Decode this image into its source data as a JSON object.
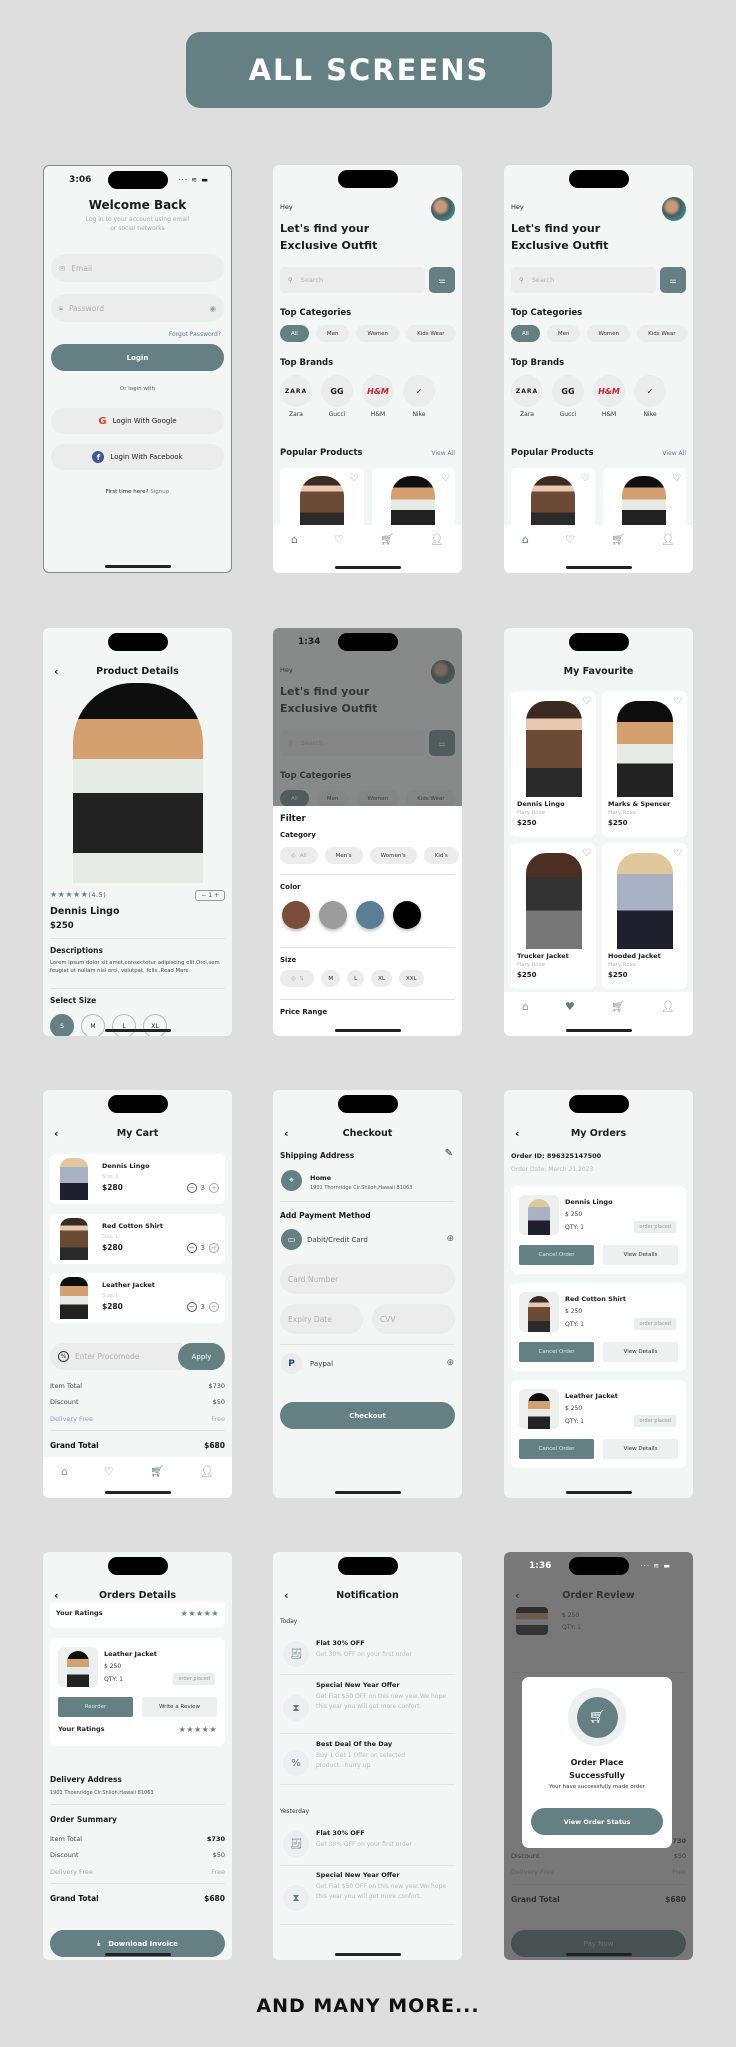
{
  "banner": {
    "title": "ALL SCREENS"
  },
  "footer": {
    "text": "AND MANY MORE..."
  },
  "colors": {
    "accent": "#648083",
    "background": "#dedede",
    "screen": "#f4f6f6"
  },
  "login": {
    "time": "3:06",
    "title": "Welcome Back",
    "subtitle": "Log in to your account using email or social networks",
    "email_placeholder": "Email",
    "password_placeholder": "Password",
    "forgot": "Forgot Password?",
    "login_button": "Login",
    "or_login": "Or login with",
    "google": "Login With Google",
    "facebook": "Login With Facebook",
    "first_time": "First time here?",
    "signup": "Signup"
  },
  "home": {
    "hey": "Hey",
    "title": "Let's find your Exclusive Outfit",
    "search_placeholder": "Search",
    "top_categories": "Top Categories",
    "categories": [
      "All",
      "Men",
      "Women",
      "Kids Wear"
    ],
    "top_brands": "Top Brands",
    "brands": [
      {
        "name": "Zara",
        "logo": "ZARA"
      },
      {
        "name": "Gucci",
        "logo": "GG"
      },
      {
        "name": "H&M",
        "logo": "H&M"
      },
      {
        "name": "Nike",
        "logo": "✓"
      }
    ],
    "popular_products": "Popular Products",
    "view_all": "View All"
  },
  "product_details": {
    "title": "Product Details",
    "rating": "(4.5)",
    "quantity": "1",
    "name": "Dennis Lingo",
    "price": "$250",
    "descriptions_title": "Descriptions",
    "description": "Lorem ipsum dolor sit amet,consectetur adipiscing elit.Orci,sem feugiat ut nullam nisl orci, volutpat, felis..Read More",
    "select_size": "Select Size",
    "sizes": [
      "S",
      "M",
      "L",
      "XL"
    ]
  },
  "filter": {
    "time": "1:34",
    "title": "Filter",
    "category_label": "Category",
    "categories": [
      "All",
      "Men's",
      "Women's",
      "Kid's"
    ],
    "color_label": "Color",
    "colors": [
      "#7a4e3b",
      "#9c9c9c",
      "#5a7f95",
      "#000000"
    ],
    "size_label": "Size",
    "sizes": [
      "S",
      "M",
      "L",
      "XL",
      "XXL"
    ],
    "price_range_label": "Price Range"
  },
  "favourites": {
    "title": "My Favourite",
    "items": [
      {
        "name": "Dennis Lingo",
        "sub": "Hary Rose",
        "price": "$250"
      },
      {
        "name": "Marks & Spencer",
        "sub": "Hary Rose",
        "price": "$250"
      },
      {
        "name": "Trucker Jacket",
        "sub": "Hary Rose",
        "price": "$250"
      },
      {
        "name": "Hooded Jacket",
        "sub": "Hary Rose",
        "price": "$250"
      }
    ]
  },
  "cart": {
    "title": "My Cart",
    "items": [
      {
        "name": "Dennis Lingo",
        "size": "Size: L",
        "price": "$280",
        "qty": "3"
      },
      {
        "name": "Red Cotton Shirt",
        "size": "Size: L",
        "price": "$280",
        "qty": "3"
      },
      {
        "name": "Leather Jacket",
        "size": "Size: L",
        "price": "$280",
        "qty": "3"
      }
    ],
    "promo_placeholder": "Enter Procomode",
    "apply": "Apply",
    "item_total_label": "Item Total",
    "item_total": "$730",
    "discount_label": "Discount",
    "discount": "$50",
    "delivery_label": "Delivery Free",
    "delivery": "Free",
    "grand_total_label": "Grand Total",
    "grand_total": "$680"
  },
  "checkout": {
    "title": "Checkout",
    "shipping_address": "Shipping Address",
    "address_name": "Home",
    "address": "1901 Thornridge Cir.Shiloh,Hawaii 81063",
    "add_payment": "Add Payment Method",
    "card_label": "Dabit/Credit Card",
    "card_number_placeholder": "Card Number",
    "expiry_placeholder": "Expiry Date",
    "cvv_placeholder": "CVV",
    "paypal": "Paypal",
    "checkout_button": "Checkout"
  },
  "orders": {
    "title": "My Orders",
    "order_id": "Order ID: 896325147500",
    "order_date": "Order Date: March 21,2023",
    "items": [
      {
        "name": "Dennis Lingo",
        "price": "$ 250",
        "qty": "QTY: 1",
        "status": "order placed"
      },
      {
        "name": "Red Cotton Shirt",
        "price": "$ 250",
        "qty": "QTY: 1",
        "status": "order placed"
      },
      {
        "name": "Leather Jacket",
        "price": "$ 250",
        "qty": "QTY: 1",
        "status": "order placed"
      }
    ],
    "cancel": "Cancel Order",
    "view_details": "View Details"
  },
  "order_details": {
    "title": "Orders Details",
    "your_ratings": "Your Ratings",
    "rating_stars": 5,
    "item": {
      "name": "Leather Jacket",
      "price": "$ 250",
      "qty": "QTY: 1",
      "status": "order placed"
    },
    "reorder": "Reorder",
    "write_review": "Write a Review",
    "delivery_address_title": "Delivery Address",
    "delivery_address": "1901 Thoenridge Cir.Shiloh,Hawaii 81063",
    "summary_title": "Order Summary",
    "item_total_label": "Item Total",
    "item_total": "$730",
    "discount_label": "Discount",
    "discount": "$50",
    "delivery_label": "Delivery Free",
    "delivery": "Free",
    "grand_total_label": "Grand Total",
    "grand_total": "$680",
    "download": "Download Invoice"
  },
  "notifications": {
    "title": "Notification",
    "today": "Today",
    "yesterday": "Yesterday",
    "today_items": [
      {
        "title": "Flat 30% OFF",
        "desc": "Get 30% OFF on your first order",
        "icon": "receipt"
      },
      {
        "title": "Special New Year Offer",
        "desc": "Get Flat $50 OFF on this new year.We hope this year you will get more confort.",
        "icon": "hourglass"
      },
      {
        "title": "Best Deal Of the Day",
        "desc": "Buy 1 Get 1 Offer on selected product...hurry up",
        "icon": "percent"
      }
    ],
    "yesterday_items": [
      {
        "title": "Flat 30% OFF",
        "desc": "Get 30% OFF on your first order",
        "icon": "receipt"
      },
      {
        "title": "Special New Year Offer",
        "desc": "Get Flat $50 OFF on this new year.We hope this year you will get more confort.",
        "icon": "hourglass"
      }
    ]
  },
  "order_review": {
    "time": "1:36",
    "title": "Order Review",
    "price": "$ 250",
    "qty": "QTY: 1",
    "discount_label": "Discount",
    "discount": "$50",
    "delivery_label": "Delivery Free",
    "delivery": "Free",
    "grand_total_label": "Grand Total",
    "grand_total": "$680",
    "item_total": "$730",
    "pay_now": "Pay Now",
    "modal_title": "Order Place Successfully",
    "modal_text": "Your have successfully made order",
    "modal_button": "View Order Status"
  }
}
